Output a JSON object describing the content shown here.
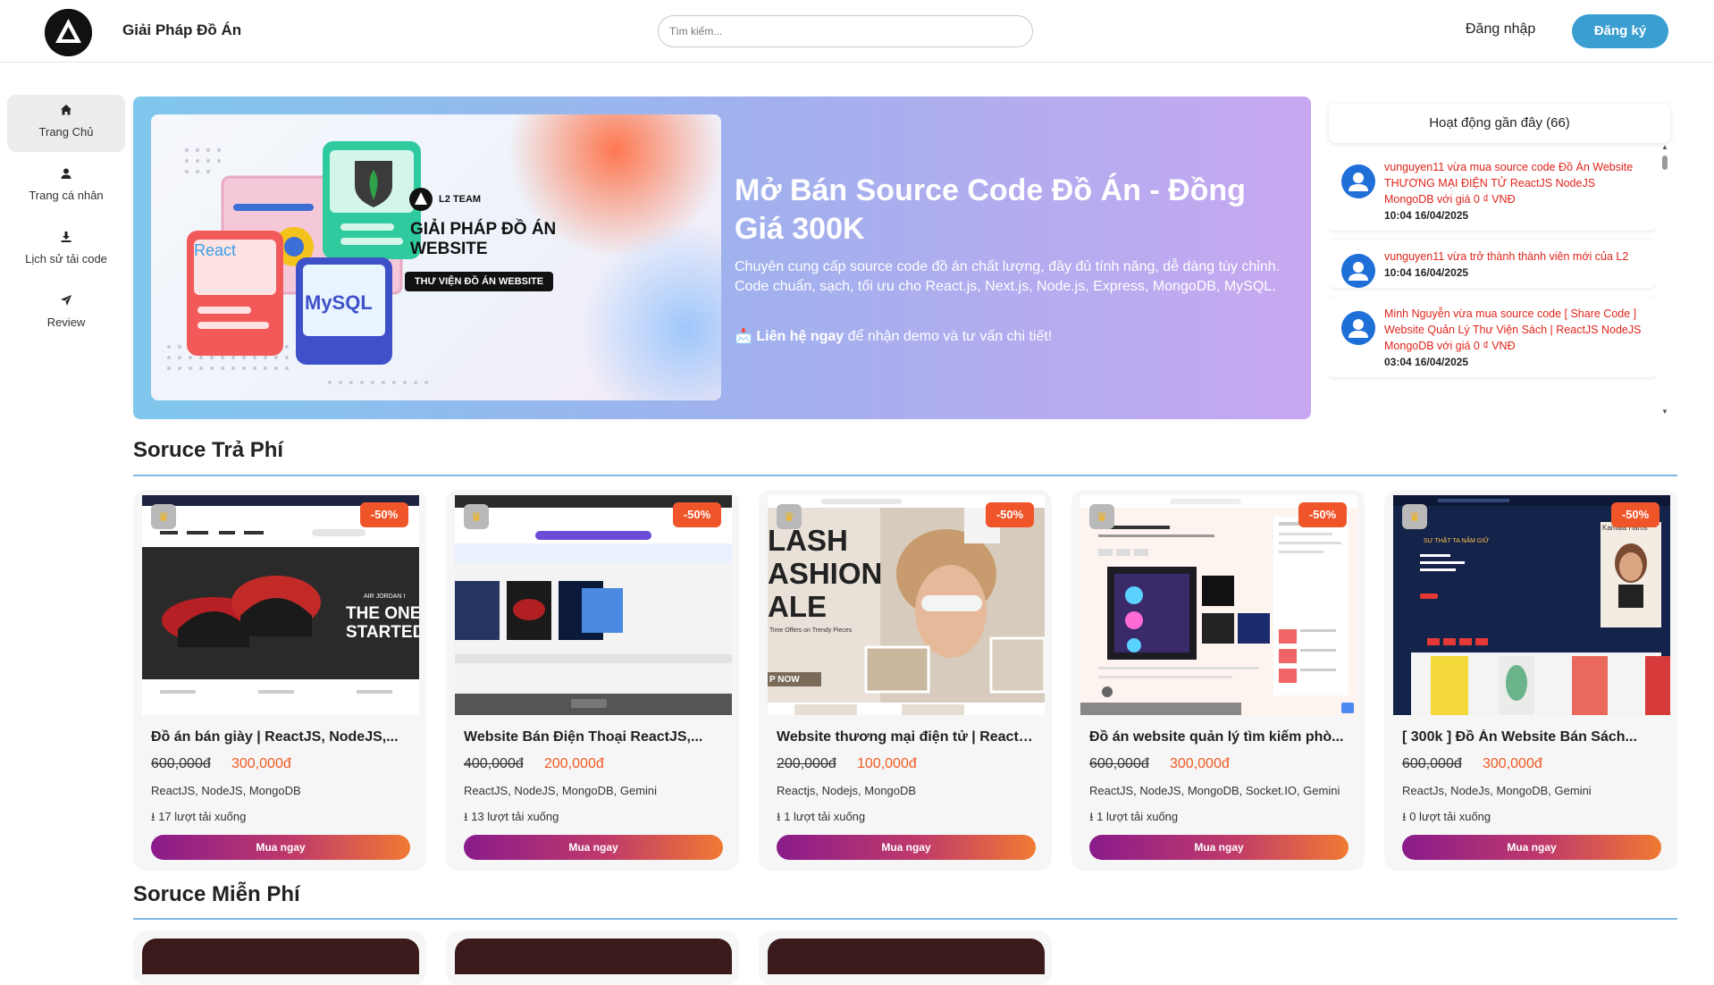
{
  "header": {
    "brand": "Giải Pháp Đồ Án",
    "search_placeholder": "Tìm kiếm...",
    "login": "Đăng nhập",
    "register": "Đăng ký"
  },
  "sidebar": {
    "items": [
      {
        "label": "Trang Chủ",
        "icon": "home-icon"
      },
      {
        "label": "Trang cá nhân",
        "icon": "user-icon"
      },
      {
        "label": "Lịch sử tải code",
        "icon": "download-icon"
      },
      {
        "label": "Review",
        "icon": "send-icon"
      }
    ]
  },
  "hero": {
    "title": "Mở Bán Source Code Đồ Án - Đồng Giá 300K",
    "description": "Chuyên cung cấp source code đồ án chất lượng, đầy đủ tính năng, dễ dàng tùy chỉnh. Code chuẩn, sạch, tối ưu cho React.js, Next.js, Node.js, Express, MongoDB, MySQL.",
    "cta_icon": "📩",
    "cta_bold": "Liên hệ ngay",
    "cta_rest": " để nhận demo và tư vấn chi tiết!",
    "image": {
      "team": "L2 TEAM",
      "heading": "GIẢI PHÁP ĐỒ ÁN WEBSITE",
      "badge": "THƯ VIỆN ĐỒ ÁN WEBSITE",
      "react": "React",
      "mysql": "MySQL"
    }
  },
  "activity": {
    "title": "Hoạt động gần đây (66)",
    "items": [
      {
        "text": "vunguyen11 vừa mua source code Đồ Án Website THƯƠNG MẠI ĐIỆN TỬ ReactJS NodeJS MongoDB với giá 0 ₫ VNĐ",
        "time": "10:04 16/04/2025"
      },
      {
        "text": "vunguyen11 vừa trở thành thành viên mới của L2",
        "time": "10:04 16/04/2025"
      },
      {
        "text": "Minh Nguyễn vừa mua source code [ Share Code ] Website Quản Lý Thư Viện Sách | ReactJS NodeJS MongoDB với giá 0 ₫ VNĐ",
        "time": "03:04 16/04/2025"
      }
    ]
  },
  "paid_section": {
    "title": "Soruce Trả Phí",
    "products": [
      {
        "name": "Đồ án bán giày | ReactJS, NodeJS,...",
        "old_price": "600,000đ",
        "new_price": "300,000đ",
        "tech": "ReactJS, NodeJS, MongoDB",
        "downloads": "17 lượt tải xuống",
        "discount": "-50%",
        "buy": "Mua ngay"
      },
      {
        "name": "Website Bán Điện Thoại ReactJS,...",
        "old_price": "400,000đ",
        "new_price": "200,000đ",
        "tech": "ReactJS, NodeJS, MongoDB, Gemini",
        "downloads": "13 lượt tải xuống",
        "discount": "-50%",
        "buy": "Mua ngay"
      },
      {
        "name": "Website thương mại điện tử | ReactJ...",
        "old_price": "200,000đ",
        "new_price": "100,000đ",
        "tech": "Reactjs, Nodejs, MongoDB",
        "downloads": "1 lượt tải xuống",
        "discount": "-50%",
        "buy": "Mua ngay"
      },
      {
        "name": "Đồ án website quản lý tìm kiếm phò...",
        "old_price": "600,000đ",
        "new_price": "300,000đ",
        "tech": "ReactJS, NodeJS, MongoDB, Socket.IO, Gemini",
        "downloads": "1 lượt tải xuống",
        "discount": "-50%",
        "buy": "Mua ngay"
      },
      {
        "name": "[ 300k ] Đồ Án Website Bán Sách...",
        "old_price": "600,000đ",
        "new_price": "300,000đ",
        "tech": "ReactJs, NodeJs, MongoDB, Gemini",
        "downloads": "0 lượt tải xuống",
        "discount": "-50%",
        "buy": "Mua ngay"
      }
    ]
  },
  "free_section": {
    "title": "Soruce Miễn Phí"
  },
  "thumb_text": {
    "shoe_line1": "THE ONE T",
    "shoe_line2": "STARTED I",
    "shoe_brand": "AIR JORDAN I",
    "fashion_1": "LASH",
    "fashion_2": "ASHION",
    "fashion_3": "ALE",
    "fashion_sub": "Time Offers on Trendy Pieces",
    "fashion_btn": "P NOW",
    "book_title": "SỰ THẬT TA NẮM GIỮ",
    "book_author": "Kamala Harris"
  },
  "colors": {
    "accent": "#3a9ed1",
    "discount": "#f0552a",
    "price": "#ef5a24",
    "activity_text": "#e0241b"
  }
}
